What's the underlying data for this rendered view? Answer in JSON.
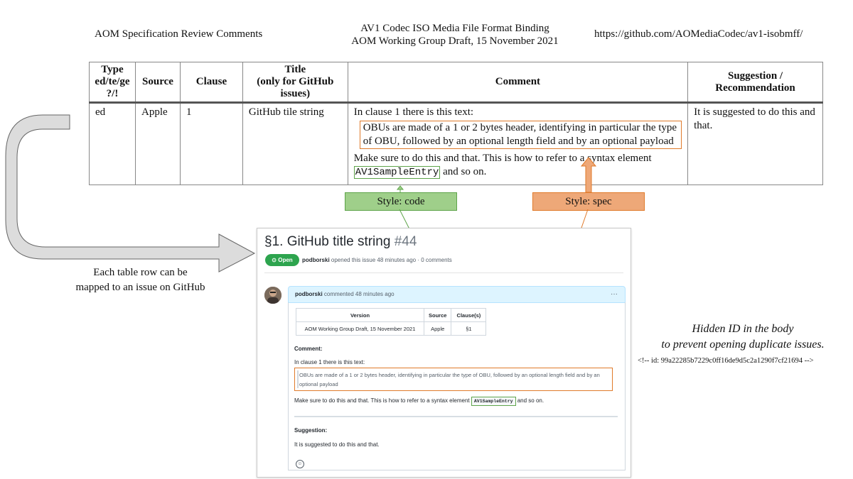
{
  "header": {
    "left": "AOM Specification Review Comments",
    "center_line1": "AV1 Codec ISO Media File Format Binding",
    "center_line2": "AOM Working Group Draft, 15 November 2021",
    "right": "https://github.com/AOMediaCodec/av1-isobmff/"
  },
  "review_table": {
    "headers": {
      "type_line1": "Type",
      "type_line2": "ed/te/ge",
      "type_line3": "?/!",
      "source": "Source",
      "clause": "Clause",
      "title_line1": "Title",
      "title_line2": "(only for GitHub",
      "title_line3": "issues)",
      "comment": "Comment",
      "suggestion_line1": "Suggestion /",
      "suggestion_line2": "Recommendation"
    },
    "row": {
      "type": "ed",
      "source": "Apple",
      "clause": "1",
      "title": "GitHub tile string",
      "comment_intro": "In clause 1 there is this text:",
      "comment_spec": "OBUs are made of a 1 or 2 bytes header, identifying in particular the type of OBU, followed by an optional length field and by an optional payload",
      "comment_after_before": "Make sure to do this and that. This is how to refer to a syntax element",
      "comment_code": "AV1SampleEntry",
      "comment_after_after": "and so on.",
      "suggestion": "It is suggested to do this and that."
    }
  },
  "labels": {
    "style_code": "Style: code",
    "style_spec": "Style: spec",
    "mapping_line1": "Each table row can be",
    "mapping_line2": "mapped to an issue on GitHub",
    "hidden_line1": "Hidden ID in the body",
    "hidden_line2": "to prevent opening duplicate issues.",
    "hidden_comment": "<!-- id: 99a22285b7229c0ff16de9d5c2a1290f7cf21694 -->"
  },
  "colors": {
    "code_fill": "#9fcf8a",
    "code_stroke": "#5ea44a",
    "spec_fill": "#eea878",
    "spec_stroke": "#e07a2a",
    "arrow_fill": "#dcdcdc",
    "arrow_stroke": "#666666",
    "open_badge": "#2da44e"
  },
  "github_issue": {
    "title": "§1. GitHub title string",
    "number": "#44",
    "status": "Open",
    "status_icon": "circle-dot-icon",
    "author": "podborski",
    "opened_text": "opened this issue 48 minutes ago · 0 comments",
    "comment_author": "podborski",
    "comment_time": "commented 48 minutes ago",
    "menu": "···",
    "table_headers": [
      "Version",
      "Source",
      "Clause(s)"
    ],
    "table_row": [
      "AOM Working Group Draft, 15 November 2021",
      "Apple",
      "§1"
    ],
    "comment_heading": "Comment:",
    "comment_intro": "In clause 1 there is this text:",
    "quote": "OBUs are made of a 1 or 2 bytes header, identifying in particular the type of OBU, followed by an optional length field and by an optional payload",
    "body_before_code": "Make sure to do this and that. This is how to refer to a syntax element",
    "code": "AV1SampleEntry",
    "body_after_code": "and so on.",
    "suggestion_heading": "Suggestion:",
    "suggestion_text": "It is suggested to do this and that.",
    "reaction_icon": "smiley-icon"
  }
}
